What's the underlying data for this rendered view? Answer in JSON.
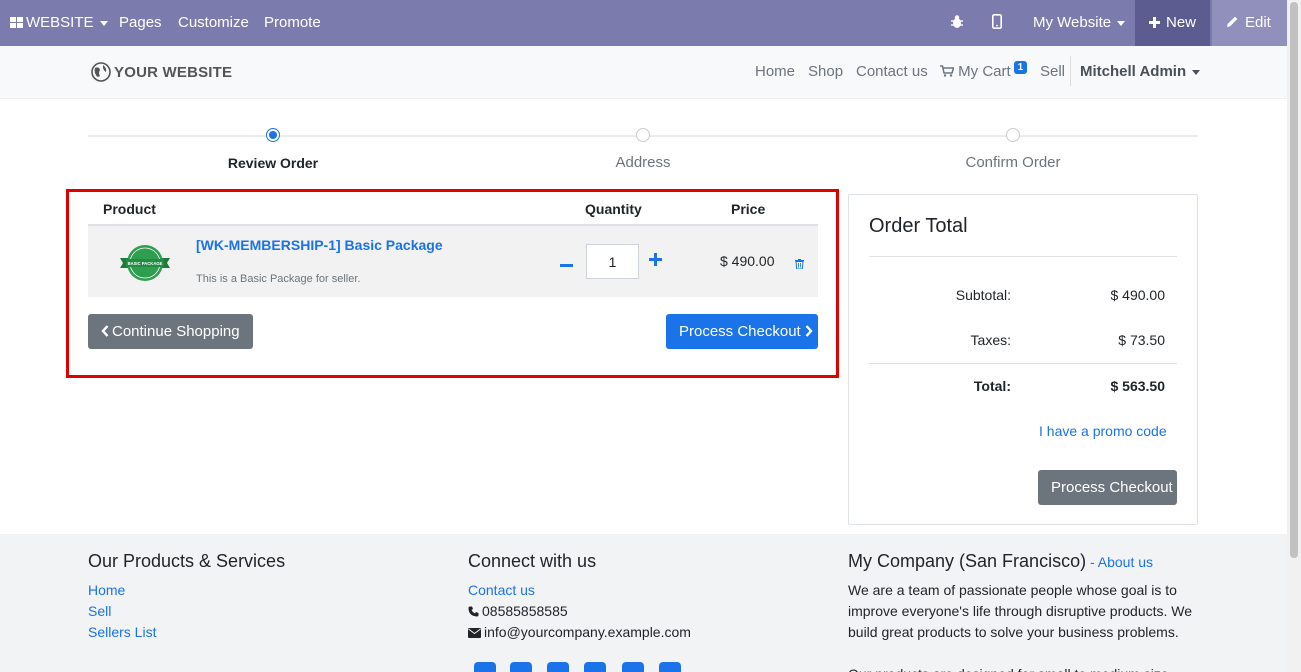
{
  "admin_bar": {
    "website_menu": "WEBSITE",
    "pages": "Pages",
    "customize": "Customize",
    "promote": "Promote",
    "my_website": "My Website",
    "new_label": "New",
    "edit_label": "Edit"
  },
  "header": {
    "logo_text": "YOUR WEBSITE",
    "nav": {
      "home": "Home",
      "shop": "Shop",
      "contact": "Contact us",
      "cart": "My Cart",
      "cart_count": "1",
      "sell": "Sell",
      "user": "Mitchell Admin"
    }
  },
  "wizard": {
    "steps": [
      "Review Order",
      "Address",
      "Confirm Order"
    ],
    "active_step": 0
  },
  "cart": {
    "columns": {
      "product": "Product",
      "quantity": "Quantity",
      "price": "Price"
    },
    "items": [
      {
        "name": "[WK-MEMBERSHIP-1] Basic Package",
        "description": "This is a Basic Package for seller.",
        "image_text": "BASIC PACKAGE",
        "quantity": "1",
        "price": "$ 490.00"
      }
    ],
    "continue_label": "Continue Shopping",
    "checkout_label": "Process Checkout"
  },
  "order_total": {
    "title": "Order Total",
    "subtotal_label": "Subtotal:",
    "subtotal_value": "$ 490.00",
    "taxes_label": "Taxes:",
    "taxes_value": "$ 73.50",
    "total_label": "Total:",
    "total_value": "$ 563.50",
    "promo_label": "I have a promo code",
    "checkout_label": "Process Checkout"
  },
  "footer": {
    "col1": {
      "title": "Our Products & Services",
      "links": [
        "Home",
        "Sell",
        "Sellers List"
      ]
    },
    "col2": {
      "title": "Connect with us",
      "contact": "Contact us",
      "phone": "08585858585",
      "email": "info@yourcompany.example.com"
    },
    "col3": {
      "title": "My Company (San Francisco)",
      "separator": " - ",
      "about": "About us",
      "text": "We are a team of passionate people whose goal is to improve everyone's life through disruptive products. We build great products to solve your business problems.",
      "text2": "Our products are designed for small to medium size"
    }
  },
  "colors": {
    "admin_bar": "#7c7bad",
    "primary": "#1a73e8",
    "highlight": "#e00000",
    "secondary": "#6c757d"
  }
}
